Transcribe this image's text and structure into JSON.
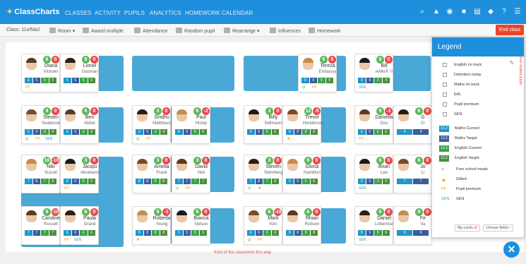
{
  "header": {
    "brand": "ClassCharts",
    "nav": [
      "CLASSES",
      "ACTIVITY",
      "PUPILS",
      "ANALYTICS",
      "HOMEWORK CALENDAR"
    ]
  },
  "toolbar": {
    "class_label": "Class: 11x/Ma2",
    "items": [
      "Room",
      "Award multiple",
      "Attendance",
      "Random pupil",
      "Rearrange",
      "Influences",
      "Homework"
    ],
    "end_class": "End class"
  },
  "colors": {
    "accent": "#1e8fdd",
    "danger": "#e84b4b",
    "positive": "#5cb85c",
    "end_class": "#e8462a"
  },
  "pupils": [
    {
      "first": "Diana",
      "last": "Vicksen",
      "pos": 6,
      "neg": 0,
      "grades": [
        "6",
        "5",
        "6",
        "5"
      ],
      "icons": [
        "pp"
      ]
    },
    {
      "first": "Lionel",
      "last": "Gasman",
      "pos": 9,
      "neg": 0,
      "grades": [
        "5",
        "5",
        "5",
        "5"
      ],
      "icons": []
    },
    {
      "first": "Tereza",
      "last": "Embassy",
      "pos": 6,
      "neg": 0,
      "grades": [
        "9",
        "9",
        "9",
        "9"
      ],
      "icons": [
        "gm",
        "pp"
      ]
    },
    {
      "first": "Bill",
      "last": "AÄlkrÄ¯n",
      "pos": 9,
      "neg": 0,
      "grades": [
        "3",
        "4",
        "3",
        "4"
      ],
      "icons": [
        "sen"
      ]
    },
    {
      "first": "Steven",
      "last": "Seaborne",
      "pos": 9,
      "neg": 0,
      "grades": [
        "5",
        "4",
        "3",
        "4"
      ],
      "icons": [
        "gm",
        "pp",
        "sen"
      ]
    },
    {
      "first": "Ben",
      "last": "Abbot",
      "pos": 6,
      "neg": 0,
      "grades": [
        "9",
        "9",
        "9",
        "9"
      ],
      "icons": []
    },
    {
      "first": "Sindhu",
      "last": "Matthews",
      "pos": 3,
      "neg": 0,
      "grades": [
        "3",
        "5",
        "3",
        "4"
      ],
      "icons": [
        "gm",
        "pp"
      ]
    },
    {
      "first": "Paul",
      "last": "Hislop",
      "pos": 6,
      "neg": -2,
      "grades": [
        "8",
        "8",
        "8",
        "8"
      ],
      "icons": []
    },
    {
      "first": "Billy",
      "last": "Sellmann",
      "pos": 3,
      "neg": 0,
      "grades": [
        "5",
        "5",
        "6",
        "6"
      ],
      "icons": []
    },
    {
      "first": "Trevor",
      "last": "Henderson",
      "pos": 12,
      "neg": -5,
      "grades": [
        "8",
        "8",
        "8",
        "8"
      ],
      "icons": [
        "gf"
      ]
    },
    {
      "first": "Daniella",
      "last": "Oss",
      "pos": 9,
      "neg": -1,
      "grades": [
        "6",
        "6",
        "6",
        "6"
      ],
      "icons": [
        "pp"
      ]
    },
    {
      "first": "G",
      "last": "Cr",
      "pos": 6,
      "neg": 0,
      "grades": [
        "4",
        "4"
      ],
      "icons": []
    },
    {
      "first": "Niki",
      "last": "Suzuki",
      "pos": 10,
      "neg": -10,
      "grades": [
        "7",
        "8",
        "7",
        "8"
      ],
      "icons": []
    },
    {
      "first": "Jacqui",
      "last": "Abrahams",
      "pos": 3,
      "neg": 0,
      "grades": [
        "6",
        "6",
        "6",
        "6"
      ],
      "icons": [
        "pp"
      ]
    },
    {
      "first": "Amelia",
      "last": "Frank",
      "pos": 3,
      "neg": 0,
      "grades": [
        "8",
        "8",
        "8",
        "8"
      ],
      "icons": []
    },
    {
      "first": "David",
      "last": "Neil",
      "pos": 3,
      "neg": 0,
      "grades": [
        "7",
        "7",
        "7",
        "7"
      ],
      "icons": [
        "gm",
        "pp"
      ]
    },
    {
      "first": "Steven",
      "last": "Sternberg",
      "pos": 3,
      "neg": 0,
      "grades": [
        "7",
        "8",
        "7",
        "8"
      ],
      "icons": [
        "gm",
        "gf"
      ]
    },
    {
      "first": "Gloria",
      "last": "Hamilton",
      "pos": 6,
      "neg": 0,
      "grades": [
        "5",
        "5",
        "6",
        "6"
      ],
      "icons": []
    },
    {
      "first": "Brian",
      "last": "Lee",
      "pos": 6,
      "neg": 0,
      "grades": [
        "3",
        "3",
        "3",
        "3"
      ],
      "icons": [
        "sen"
      ]
    },
    {
      "first": "Jo",
      "last": "Li",
      "pos": 6,
      "neg": 0,
      "grades": [
        "7",
        "7"
      ],
      "icons": []
    },
    {
      "first": "Caroline",
      "last": "Russell",
      "pos": 9,
      "neg": -10,
      "grades": [
        "7",
        "7",
        "7",
        "7"
      ],
      "icons": []
    },
    {
      "first": "Paula",
      "last": "Grand",
      "pos": 6,
      "neg": 0,
      "grades": [
        "6",
        "6",
        "6",
        "6"
      ],
      "icons": [
        "pp",
        "sen"
      ]
    },
    {
      "first": "Roberta",
      "last": "Young",
      "pos": 9,
      "neg": -1,
      "grades": [
        "8",
        "8",
        "8",
        "8"
      ],
      "icons": [
        "gf"
      ]
    },
    {
      "first": "Bianca",
      "last": "Nelson",
      "pos": 6,
      "neg": 0,
      "grades": [
        "5",
        "5",
        "5",
        "5"
      ],
      "icons": []
    },
    {
      "first": "Mark",
      "last": "Kim",
      "pos": 6,
      "neg": -10,
      "grades": [
        "6",
        "6",
        "6",
        "6"
      ],
      "icons": [
        "gm",
        "pp"
      ]
    },
    {
      "first": "Rhian",
      "last": "Robson",
      "pos": 6,
      "neg": 0,
      "grades": [
        "8",
        "8",
        "8",
        "8"
      ],
      "icons": []
    },
    {
      "first": "Daniel",
      "last": "Lotterman",
      "pos": 6,
      "neg": 0,
      "grades": [
        "9",
        "9",
        "9",
        "9"
      ],
      "icons": [
        "sen"
      ]
    },
    {
      "first": "Fe",
      "last": "Va",
      "pos": 9,
      "neg": 0,
      "grades": [
        "9",
        "9"
      ],
      "icons": []
    }
  ],
  "legend": {
    "title": "Legend",
    "checks": [
      "English on track",
      "Detention today",
      "Maths on track",
      "EAL",
      "Pupil premium",
      "SEN"
    ],
    "badges": [
      {
        "tag": "13.2",
        "label": "Maths Current",
        "color": "#2196c9"
      },
      {
        "tag": "13.2",
        "label": "Maths Target",
        "color": "#3a5e9c"
      },
      {
        "tag": "13.2",
        "label": "English Current",
        "color": "#3aa34a"
      },
      {
        "tag": "13.2",
        "label": "English Target",
        "color": "#4c8f3b"
      }
    ],
    "symbols": [
      {
        "icon": "fork-knife-icon",
        "label": "Free school meals"
      },
      {
        "icon": "star-icon",
        "label": "Gifted"
      },
      {
        "icon": "pp-icon",
        "label": "Pupil premium"
      },
      {
        "icon": "sen-icon",
        "label": "SEN"
      }
    ],
    "flip": "flip cards",
    "choose": "choose fields",
    "side": "show seated pupils"
  },
  "room": {
    "front": "front of the classroom this way"
  }
}
